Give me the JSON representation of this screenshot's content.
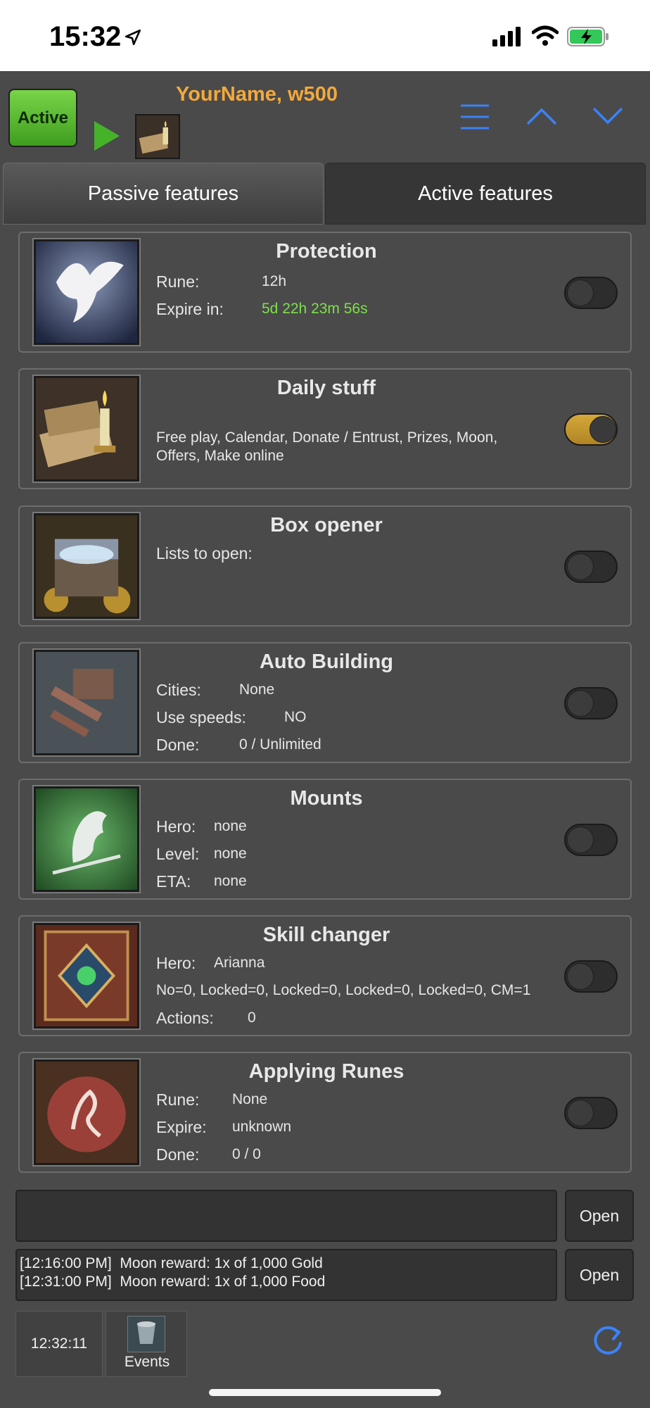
{
  "status_bar": {
    "time": "15:32"
  },
  "header": {
    "active_label": "Active",
    "username": "YourName, w500"
  },
  "tabs": [
    {
      "label": "Passive features",
      "selected": false
    },
    {
      "label": "Active features",
      "selected": true
    }
  ],
  "features": {
    "protection": {
      "title": "Protection",
      "rune_label": "Rune:",
      "rune_value": "12h",
      "expire_label": "Expire in:",
      "expire_value": "5d 22h 23m 56s",
      "enabled": false
    },
    "daily": {
      "title": "Daily stuff",
      "description": "Free play, Calendar, Donate / Entrust, Prizes, Moon, Offers, Make online",
      "enabled": true
    },
    "box": {
      "title": "Box opener",
      "lists_label": "Lists to open:",
      "enabled": false
    },
    "building": {
      "title": "Auto Building",
      "cities_label": "Cities:",
      "cities_value": "None",
      "speeds_label": "Use speeds:",
      "speeds_value": "NO",
      "done_label": "Done:",
      "done_value": "0 / Unlimited",
      "enabled": false
    },
    "mounts": {
      "title": "Mounts",
      "hero_label": "Hero:",
      "hero_value": "none",
      "level_label": "Level:",
      "level_value": "none",
      "eta_label": "ETA:",
      "eta_value": "none",
      "enabled": false
    },
    "skill": {
      "title": "Skill changer",
      "hero_label": "Hero:",
      "hero_value": "Arianna",
      "summary": "No=0, Locked=0, Locked=0, Locked=0, Locked=0, CM=1",
      "actions_label": "Actions:",
      "actions_value": "0",
      "enabled": false
    },
    "runes": {
      "title": "Applying Runes",
      "rune_label": "Rune:",
      "rune_value": "None",
      "expire_label": "Expire:",
      "expire_value": "unknown",
      "done_label": "Done:",
      "done_value": "0 / 0",
      "enabled": false
    }
  },
  "bottom": {
    "open_label_1": "Open",
    "open_label_2": "Open",
    "log_line_1": "[12:16:00 PM]  Moon reward: 1x of 1,000 Gold",
    "log_line_2": "[12:31:00 PM]  Moon reward: 1x of 1,000 Food",
    "clock": "12:32:11",
    "events_label": "Events"
  },
  "colors": {
    "username": "#f2a93b",
    "expire_green": "#7ee04a",
    "accent_blue": "#3b82f6",
    "toggle_on": "#c99a30"
  }
}
